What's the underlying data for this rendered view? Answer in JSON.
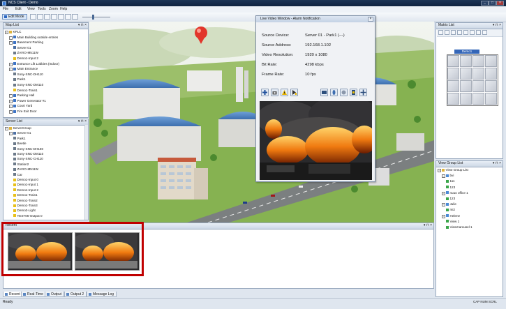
{
  "window": {
    "title": "NCS Client - Demo",
    "min": "_",
    "max": "□",
    "close": "×"
  },
  "menu": [
    "File",
    "Edit",
    "View",
    "Tools",
    "Zoom",
    "Help"
  ],
  "toolbar": {
    "edit_mode": "Edit Mode"
  },
  "map_list": {
    "title": "Map List",
    "items": [
      {
        "label": "KPLC",
        "depth": 0,
        "type": "folder"
      },
      {
        "label": "Main Building outside entries",
        "depth": 1,
        "type": "map"
      },
      {
        "label": "Basement Parking",
        "depth": 1,
        "type": "map"
      },
      {
        "label": "Server 01",
        "depth": 2,
        "type": "server"
      },
      {
        "label": "ZAVIO-M511W",
        "depth": 2,
        "type": "cam"
      },
      {
        "label": "Demo1-Input 2",
        "depth": 2,
        "type": "input"
      },
      {
        "label": "Entrance Lift Lobbies (Indoor)",
        "depth": 1,
        "type": "map"
      },
      {
        "label": "Main Entrance",
        "depth": 1,
        "type": "map"
      },
      {
        "label": "Sony-SNC-DH110",
        "depth": 2,
        "type": "cam"
      },
      {
        "label": "Park1",
        "depth": 2,
        "type": "cam"
      },
      {
        "label": "Sony-SNC-DM110",
        "depth": 2,
        "type": "cam"
      },
      {
        "label": "Demo1-Train1",
        "depth": 2,
        "type": "input"
      },
      {
        "label": "Parking Hall",
        "depth": 1,
        "type": "map"
      },
      {
        "label": "Power Generator #1",
        "depth": 1,
        "type": "map"
      },
      {
        "label": "Court Yard",
        "depth": 1,
        "type": "map"
      },
      {
        "label": "Fire Exit Door",
        "depth": 1,
        "type": "map"
      }
    ]
  },
  "server_list": {
    "title": "Server List",
    "items": [
      {
        "label": "ServerGroup",
        "depth": 0,
        "type": "folder"
      },
      {
        "label": "Server 01",
        "depth": 1,
        "type": "server"
      },
      {
        "label": "Park1",
        "depth": 2,
        "type": "cam"
      },
      {
        "label": "Beetle",
        "depth": 2,
        "type": "cam"
      },
      {
        "label": "Sony-SNC-DH160",
        "depth": 2,
        "type": "cam"
      },
      {
        "label": "Sony-SNC-DM110",
        "depth": 2,
        "type": "cam"
      },
      {
        "label": "Sony-SNC-CH110",
        "depth": 2,
        "type": "cam"
      },
      {
        "label": "Station2",
        "depth": 2,
        "type": "cam"
      },
      {
        "label": "ZAVIO-M511W",
        "depth": 2,
        "type": "cam"
      },
      {
        "label": "Car",
        "depth": 2,
        "type": "cam"
      },
      {
        "label": "Demo1-Input 0",
        "depth": 2,
        "type": "input"
      },
      {
        "label": "Demo1-Input 1",
        "depth": 2,
        "type": "input"
      },
      {
        "label": "Demo1-Input 2",
        "depth": 2,
        "type": "input"
      },
      {
        "label": "Demo1-Train1",
        "depth": 2,
        "type": "input"
      },
      {
        "label": "Demo1-Train2",
        "depth": 2,
        "type": "input"
      },
      {
        "label": "Demo1-Train3",
        "depth": 2,
        "type": "input"
      },
      {
        "label": "Demo2-Light",
        "depth": 2,
        "type": "input"
      },
      {
        "label": "TEST06-Output 0",
        "depth": 2,
        "type": "input"
      }
    ]
  },
  "video_window": {
    "title": "Live Video Window - Alarm Notification",
    "fields": [
      {
        "label": "Source Device:",
        "value": "Server 01 - Park1 (---)"
      },
      {
        "label": "Source Address:",
        "value": "192.168.1.102"
      },
      {
        "label": "Video Resolution:",
        "value": "1920 x 1080"
      },
      {
        "label": "Bit Rate:",
        "value": "4298 kbps"
      },
      {
        "label": "Frame Rate:",
        "value": "10 fps"
      }
    ]
  },
  "matrix_list": {
    "title": "Matrix List",
    "selected": "Demo1"
  },
  "view_group_list": {
    "title": "View Group List",
    "items": [
      {
        "label": "View Group List",
        "depth": 0
      },
      {
        "label": "bvi",
        "depth": 1
      },
      {
        "label": "111",
        "depth": 2
      },
      {
        "label": "123",
        "depth": 2
      },
      {
        "label": "nuuo office 1",
        "depth": 1
      },
      {
        "label": "123",
        "depth": 2
      },
      {
        "label": "Julie",
        "depth": 1
      },
      {
        "label": "mi2",
        "depth": 2
      },
      {
        "label": "Helene",
        "depth": 1
      },
      {
        "label": "View 1",
        "depth": 2
      },
      {
        "label": "ViewCarousel 1",
        "depth": 2
      }
    ]
  },
  "recent": {
    "title": "Recent"
  },
  "bottom_tabs": [
    "Recent",
    "Real-Time",
    "Output",
    "Output 2",
    "Message Log"
  ],
  "status": {
    "left": "Ready",
    "right": "CAP  NUM  SCRL"
  },
  "colors": {
    "accent": "#c00000",
    "titlebar": "#1d3556"
  }
}
